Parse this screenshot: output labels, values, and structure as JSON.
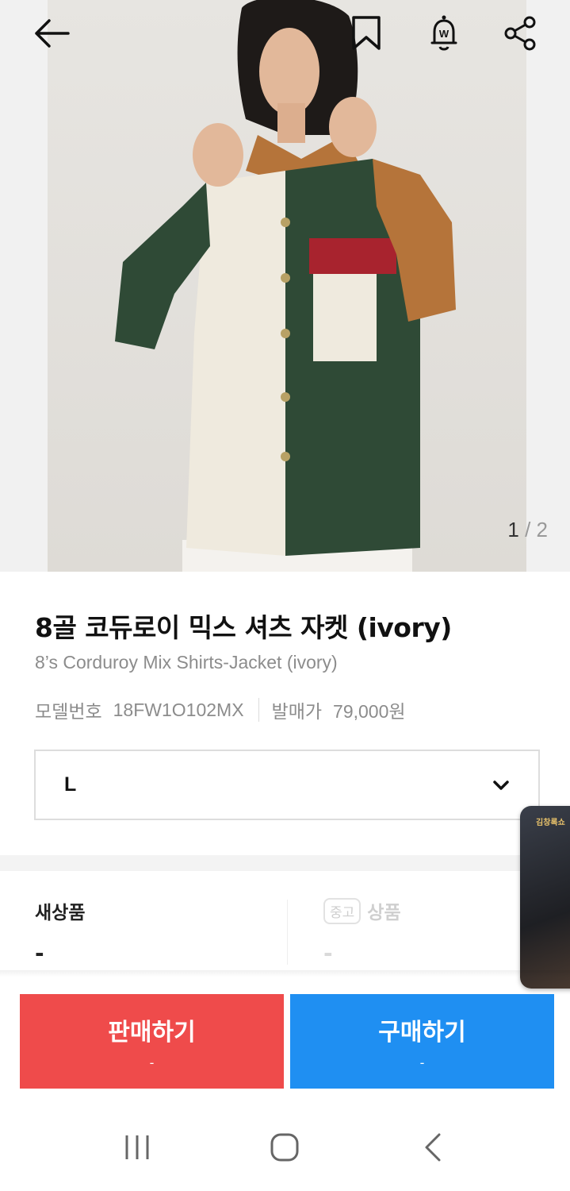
{
  "hero": {
    "current_page": "1",
    "separator": "/",
    "total_pages": "2"
  },
  "toolbar": {
    "back_icon": "arrow-left-icon",
    "bookmark_icon": "bookmark-icon",
    "alarm_icon": "bell-w-icon",
    "share_icon": "share-icon"
  },
  "product": {
    "title": "8골 코듀로이 믹스 셔츠 자켓 (ivory)",
    "subtitle": "8’s Corduroy Mix Shirts-Jacket (ivory)",
    "model_label": "모델번호",
    "model_value": "18FW1O102MX",
    "release_label": "발매가",
    "release_value": "79,000원"
  },
  "size_select": {
    "value": "L"
  },
  "prices": {
    "new_label": "새상품",
    "new_price": "-",
    "used_badge": "중고",
    "used_label": "상품",
    "used_price": "-"
  },
  "video_thumb": {
    "text": "김창록쇼"
  },
  "actions": {
    "sell_label": "판매하기",
    "sell_sub": "-",
    "buy_label": "구매하기",
    "buy_sub": "-"
  },
  "colors": {
    "sell": "#ef4b4b",
    "buy": "#1f8ff2"
  },
  "nav": {
    "recent_icon": "recent-apps-icon",
    "home_icon": "home-icon",
    "back_icon": "nav-back-icon"
  }
}
